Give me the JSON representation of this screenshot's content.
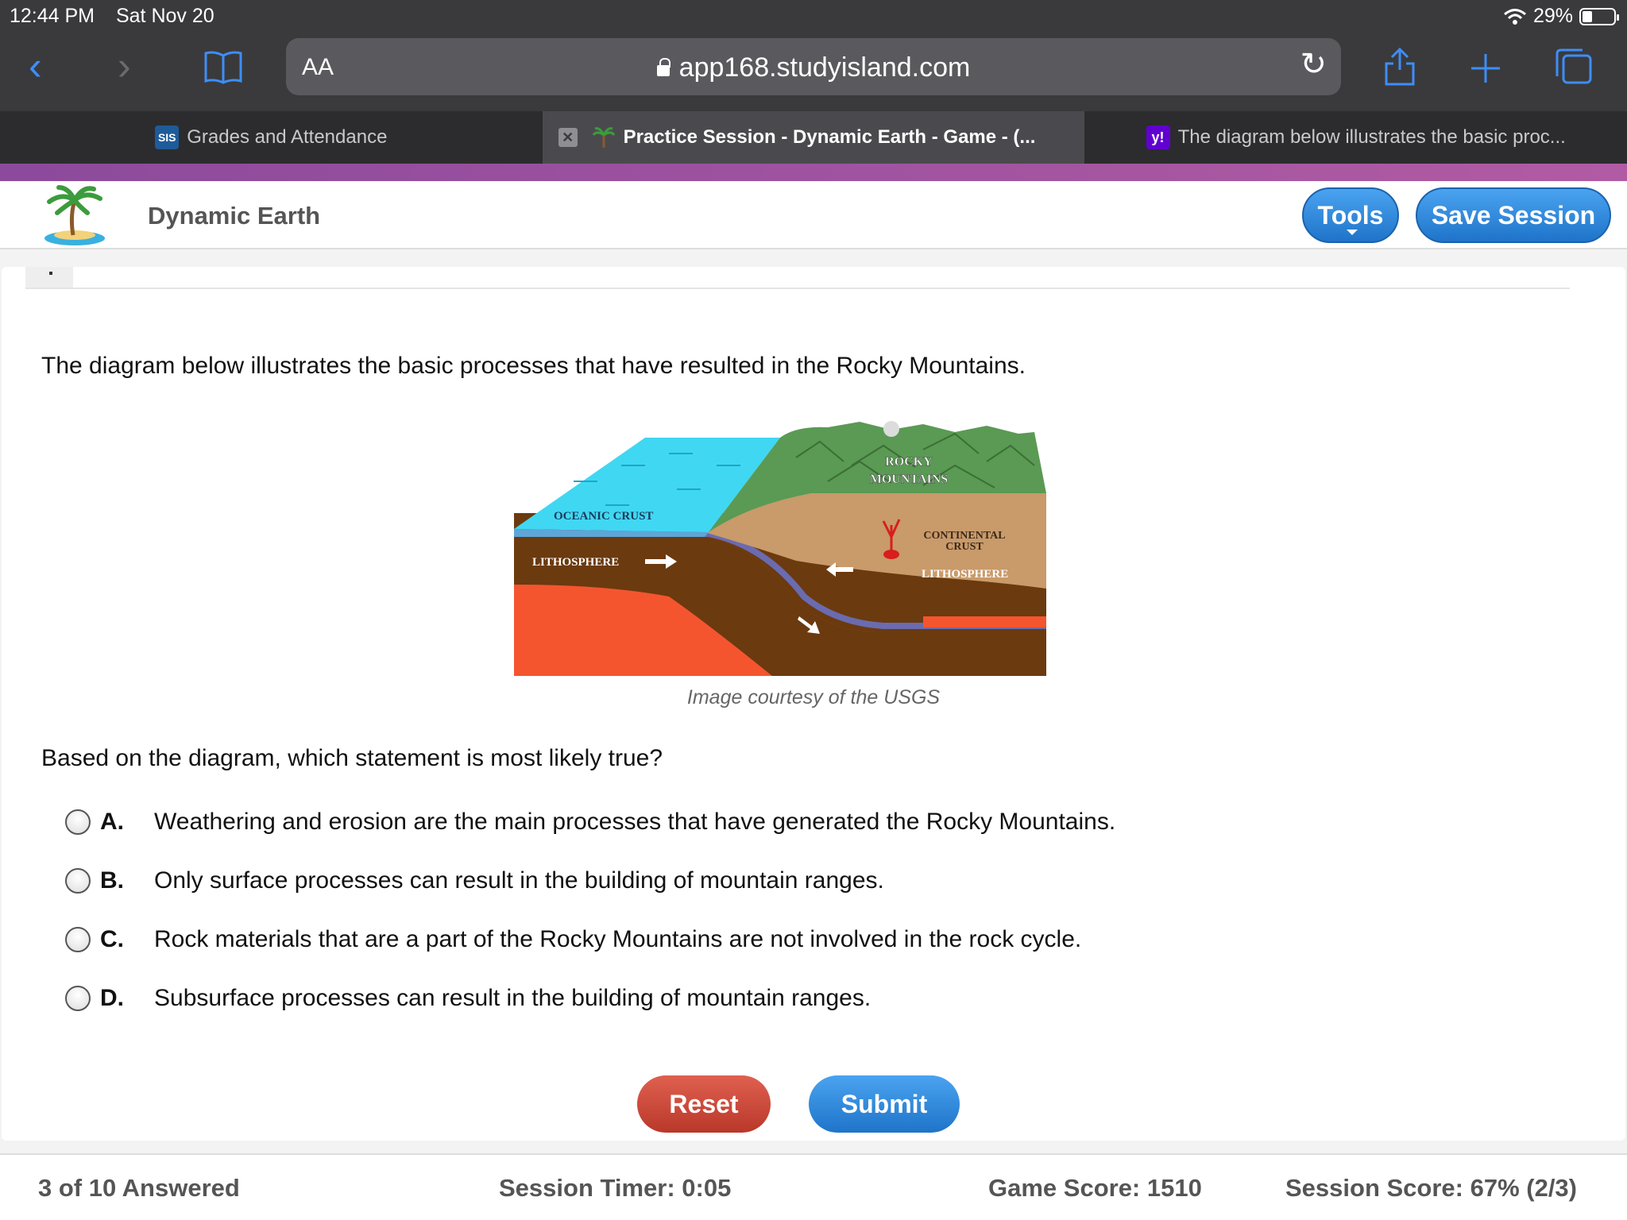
{
  "status": {
    "time": "12:44 PM",
    "date": "Sat Nov 20",
    "battery": "29%"
  },
  "browser": {
    "text_size": "AA",
    "url": "app168.studyisland.com",
    "tabs": [
      {
        "label": "Grades and Attendance",
        "favicon": "SIS"
      },
      {
        "label": "Practice Session - Dynamic Earth - Game - (..."
      },
      {
        "label": "The diagram below illustrates the basic proc...",
        "favicon": "y!"
      }
    ]
  },
  "app": {
    "title": "Dynamic Earth",
    "tools_label": "Tools",
    "save_label": "Save Session"
  },
  "question": {
    "stem": "The diagram below illustrates the basic processes that have resulted in the Rocky Mountains.",
    "diagram_labels": {
      "rocky": "ROCKY",
      "mountains": "MOUNTAINS",
      "oceanic": "OCEANIC CRUST",
      "continental": "CONTINENTAL",
      "crust": "CRUST",
      "lith_left": "LITHOSPHERE",
      "lith_right": "LITHOSPHERE"
    },
    "caption": "Image courtesy of the USGS",
    "prompt": "Based on the diagram, which statement is most likely true?",
    "choices": [
      {
        "letter": "A.",
        "text": "Weathering and erosion are the main processes that have generated the Rocky Mountains."
      },
      {
        "letter": "B.",
        "text": "Only surface processes can result in the building of mountain ranges."
      },
      {
        "letter": "C.",
        "text": "Rock materials that are a part of the Rocky Mountains are not involved in the rock cycle."
      },
      {
        "letter": "D.",
        "text": "Subsurface processes can result in the building of mountain ranges."
      }
    ],
    "reset_label": "Reset",
    "submit_label": "Submit"
  },
  "footer": {
    "answered": "3 of 10 Answered",
    "timer": "Session Timer: 0:05",
    "game_score": "Game Score: 1510",
    "session_score": "Session Score: 67% (2/3)"
  },
  "colors": {
    "accent_blue": "#2a86db",
    "reset_red": "#c9463a",
    "brand_purple": "#9a4fa0"
  }
}
